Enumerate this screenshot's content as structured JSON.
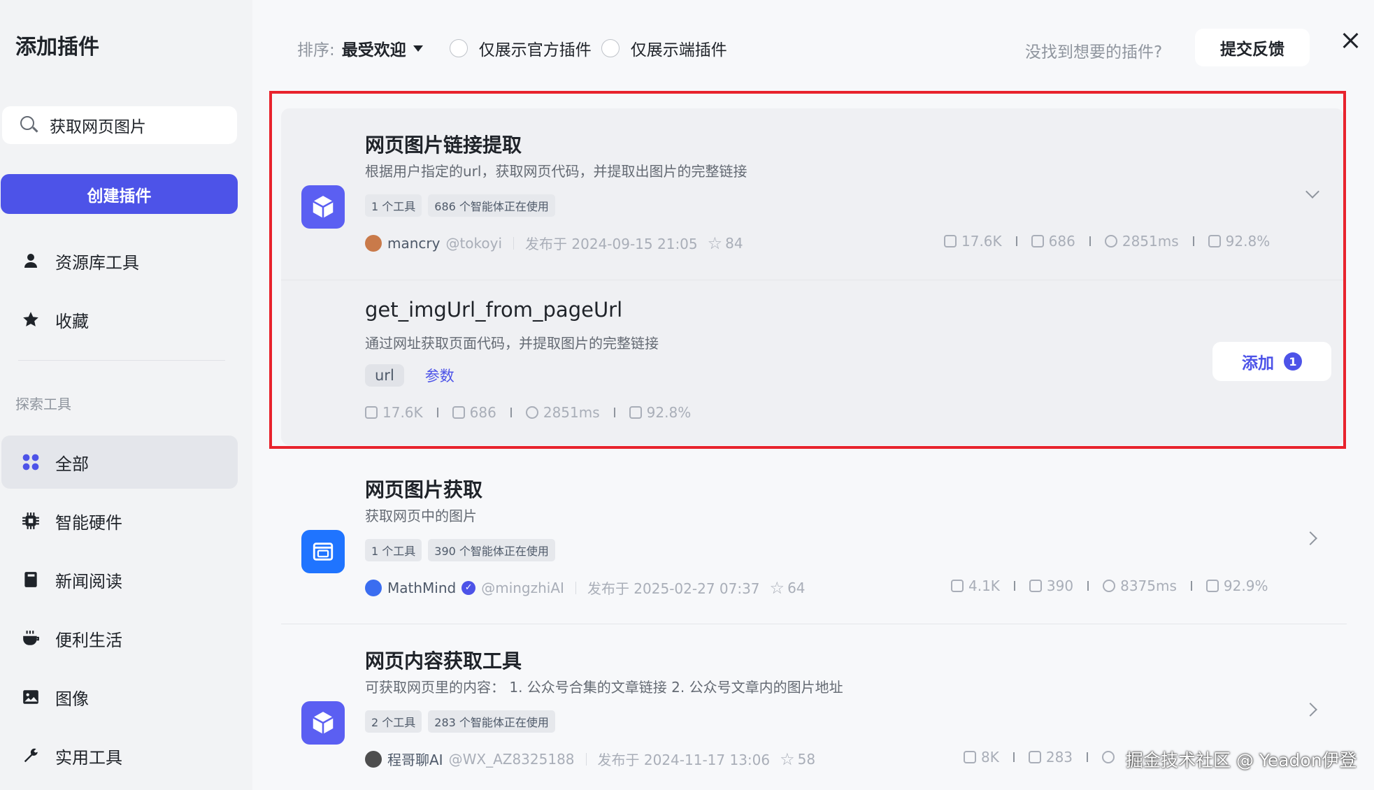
{
  "sidebar": {
    "title": "添加插件",
    "search_value": "获取网页图片",
    "create_label": "创建插件",
    "nav": [
      {
        "label": "资源库工具",
        "icon": "user-icon"
      },
      {
        "label": "收藏",
        "icon": "star-icon"
      }
    ],
    "section_label": "探索工具",
    "categories": [
      {
        "label": "全部",
        "icon": "grid-icon",
        "active": true
      },
      {
        "label": "智能硬件",
        "icon": "chip-icon"
      },
      {
        "label": "新闻阅读",
        "icon": "book-icon"
      },
      {
        "label": "便利生活",
        "icon": "cup-icon"
      },
      {
        "label": "图像",
        "icon": "image-icon"
      },
      {
        "label": "实用工具",
        "icon": "wrench-icon"
      }
    ]
  },
  "topbar": {
    "sort_label": "排序:",
    "sort_value": "最受欢迎",
    "filter_official": "仅展示官方插件",
    "filter_endside": "仅展示端插件",
    "not_found": "没找到想要的插件?",
    "feedback_label": "提交反馈"
  },
  "plugins": [
    {
      "title": "网页图片链接提取",
      "desc": "根据用户指定的url，获取网页代码，并提取出图片的完整链接",
      "tags": [
        "1 个工具",
        "686 个智能体正在使用"
      ],
      "author": "mancry",
      "handle": "@tokoyi",
      "published": "发布于 2024-09-15 21:05",
      "stars": "84",
      "stats": [
        "17.6K",
        "686",
        "2851ms",
        "92.8%"
      ],
      "icon_color": "#5b5ff2",
      "tool": {
        "name": "get_imgUrl_from_pageUrl",
        "desc": "通过网址获取页面代码，并提取图片的完整链接",
        "param": "url",
        "param_link": "参数",
        "stats": [
          "17.6K",
          "686",
          "2851ms",
          "92.8%"
        ],
        "add_label": "添加",
        "add_count": "1"
      }
    },
    {
      "title": "网页图片获取",
      "desc": "获取网页中的图片",
      "tags": [
        "1 个工具",
        "390 个智能体正在使用"
      ],
      "author": "MathMind",
      "handle": "@mingzhiAI",
      "published": "发布于 2025-02-27 07:37",
      "stars": "64",
      "stats": [
        "4.1K",
        "390",
        "8375ms",
        "92.9%"
      ],
      "icon_color": "#1f74ff"
    },
    {
      "title": "网页内容获取工具",
      "desc": "可获取网页里的内容： 1. 公众号合集的文章链接 2. 公众号文章内的图片地址",
      "tags": [
        "2 个工具",
        "283 个智能体正在使用"
      ],
      "author": "程哥聊AI",
      "handle": "@WX_AZ8325188",
      "published": "发布于 2024-11-17 13:06",
      "stars": "58",
      "stats": [
        "8K",
        "283"
      ],
      "icon_color": "#5b5ff2"
    }
  ],
  "watermark": "掘金技术社区 @ Yeadon伊登",
  "colors": {
    "accent": "#4d53e8",
    "highlight": "#e8232d"
  }
}
